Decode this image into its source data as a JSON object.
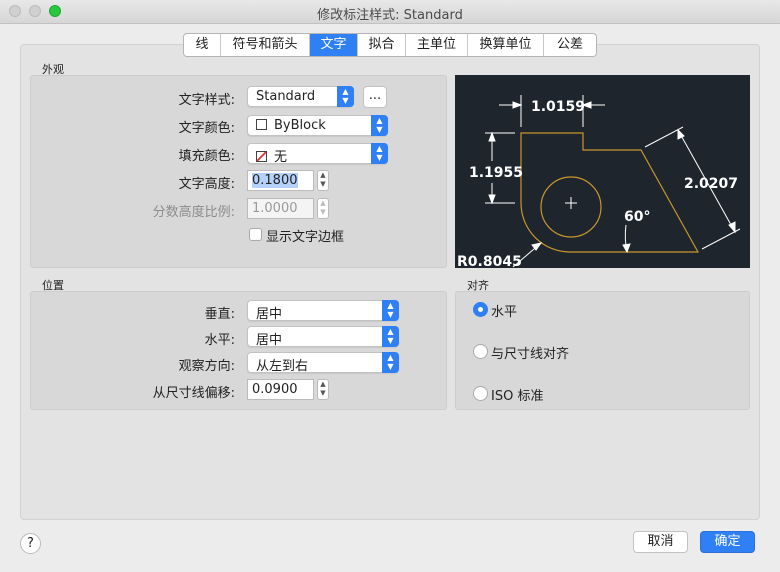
{
  "window": {
    "title": "修改标注样式: Standard"
  },
  "tabs": [
    "线",
    "符号和箭头",
    "文字",
    "拟合",
    "主单位",
    "换算单位",
    "公差"
  ],
  "active_tab": "文字",
  "appearance": {
    "section_label": "外观",
    "text_style_label": "文字样式:",
    "text_style_value": "Standard",
    "text_style_button": "...",
    "text_color_label": "文字颜色:",
    "text_color_value": "ByBlock",
    "fill_color_label": "填充颜色:",
    "fill_color_value": "无",
    "text_height_label": "文字高度:",
    "text_height_value": "0.1800",
    "fraction_scale_label": "分数高度比例:",
    "fraction_scale_value": "1.0000",
    "draw_frame_label": "显示文字边框",
    "draw_frame_checked": false
  },
  "preview": {
    "dim_top": "1.0159",
    "dim_left": "1.1955",
    "dim_right": "2.0207",
    "angle": "60°",
    "radius": "R0.8045"
  },
  "placement": {
    "section_label": "位置",
    "vertical_label": "垂直:",
    "vertical_value": "居中",
    "horizontal_label": "水平:",
    "horizontal_value": "居中",
    "view_direction_label": "观察方向:",
    "view_direction_value": "从左到右",
    "offset_label": "从尺寸线偏移:",
    "offset_value": "0.0900"
  },
  "alignment": {
    "section_label": "对齐",
    "options": [
      "水平",
      "与尺寸线对齐",
      "ISO 标准"
    ],
    "selected": "水平"
  },
  "footer": {
    "help": "?",
    "cancel": "取消",
    "ok": "确定"
  },
  "colors": {
    "accent": "#2f7ff5",
    "preview_bg": "#1f252d",
    "geometry": "#c8962e"
  }
}
